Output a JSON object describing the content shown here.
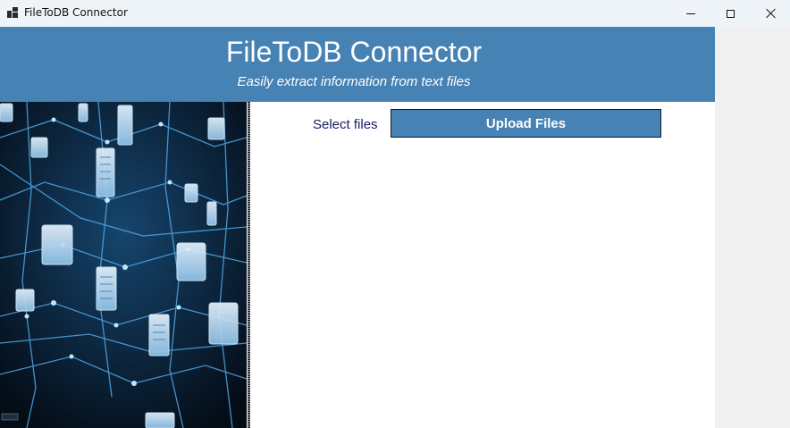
{
  "window": {
    "title": "FileToDB Connector"
  },
  "header": {
    "title": "FileToDB Connector",
    "subtitle": "Easily extract information from text files"
  },
  "main": {
    "select_label": "Select files",
    "upload_button": "Upload Files"
  },
  "colors": {
    "header_bg": "#4682b4",
    "button_bg": "#4682b4",
    "label_text": "#1a1a66"
  },
  "image": {
    "description_icon": "network-files-illustration"
  }
}
